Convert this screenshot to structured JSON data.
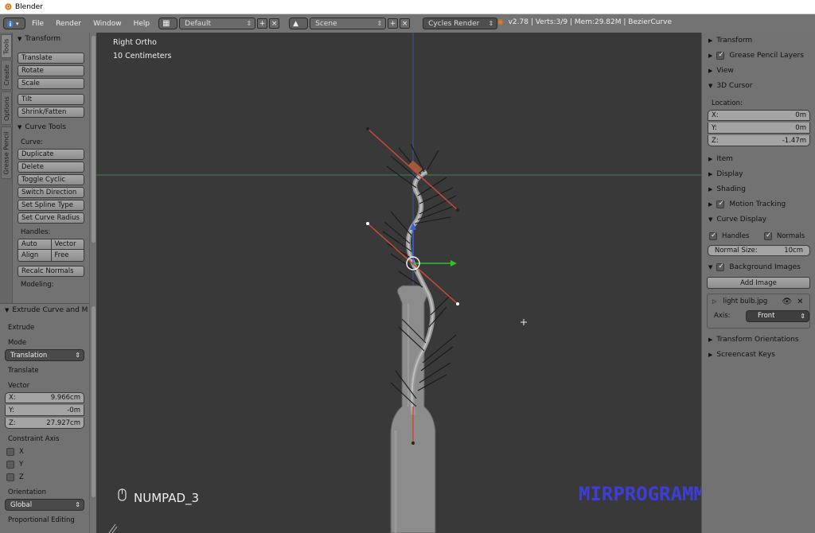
{
  "title": "Blender",
  "menu": {
    "items": [
      "File",
      "Render",
      "Window",
      "Help"
    ]
  },
  "header": {
    "layout": "Default",
    "scene": "Scene",
    "engine": "Cycles Render",
    "status": "v2.78 | Verts:3/9 | Mem:29.82M | BezierCurve"
  },
  "tabs": [
    "Tools",
    "Create",
    "Options",
    "Grease Pencil"
  ],
  "tools": {
    "transform_title": "Transform",
    "transform_buttons": [
      "Translate",
      "Rotate",
      "Scale"
    ],
    "transform_buttons2": [
      "Tilt",
      "Shrink/Fatten"
    ],
    "curve_tools_title": "Curve Tools",
    "curve_label": "Curve:",
    "curve_buttons": [
      "Duplicate",
      "Delete",
      "Toggle Cyclic",
      "Switch Direction",
      "Set Spline Type",
      "Set Curve Radius"
    ],
    "handles_label": "Handles:",
    "handles": [
      "Auto",
      "Vector",
      "Align",
      "Free"
    ],
    "recalc": "Recalc Normals",
    "modeling_label": "Modeling:"
  },
  "operator": {
    "title": "Extrude Curve and M",
    "extrude_label": "Extrude",
    "mode_label": "Mode",
    "mode_value": "Translation",
    "translate_label": "Translate",
    "vector_label": "Vector",
    "vector": [
      {
        "axis": "X:",
        "value": "9.966cm"
      },
      {
        "axis": "Y:",
        "value": "-0m"
      },
      {
        "axis": "Z:",
        "value": "27.927cm"
      }
    ],
    "constraint_label": "Constraint Axis",
    "constraints": [
      "X",
      "Y",
      "Z"
    ],
    "orientation_label": "Orientation",
    "orientation_value": "Global",
    "proportional_label": "Proportional Editing"
  },
  "viewport": {
    "view_name": "Right Ortho",
    "scale": "10 Centimeters",
    "key": "NUMPAD_3",
    "watermark": "MIRPROGRAMM.RU"
  },
  "properties": {
    "transform": "Transform",
    "grease": "Grease Pencil Layers",
    "view": "View",
    "cursor_title": "3D Cursor",
    "location_label": "Location:",
    "location": [
      {
        "axis": "X:",
        "value": "0m"
      },
      {
        "axis": "Y:",
        "value": "0m"
      },
      {
        "axis": "Z:",
        "value": "-1.47m"
      }
    ],
    "item": "Item",
    "display": "Display",
    "shading": "Shading",
    "motion": "Motion Tracking",
    "curve_display": "Curve Display",
    "handles": "Handles",
    "normals": "Normals",
    "normal_size_label": "Normal Size:",
    "normal_size_value": "10cm",
    "bg_images": "Background Images",
    "add_image": "Add Image",
    "image_name": "light bulb.jpg",
    "axis_label": "Axis:",
    "axis_value": "Front",
    "transform_orient": "Transform Orientations",
    "screencast": "Screencast Keys"
  }
}
